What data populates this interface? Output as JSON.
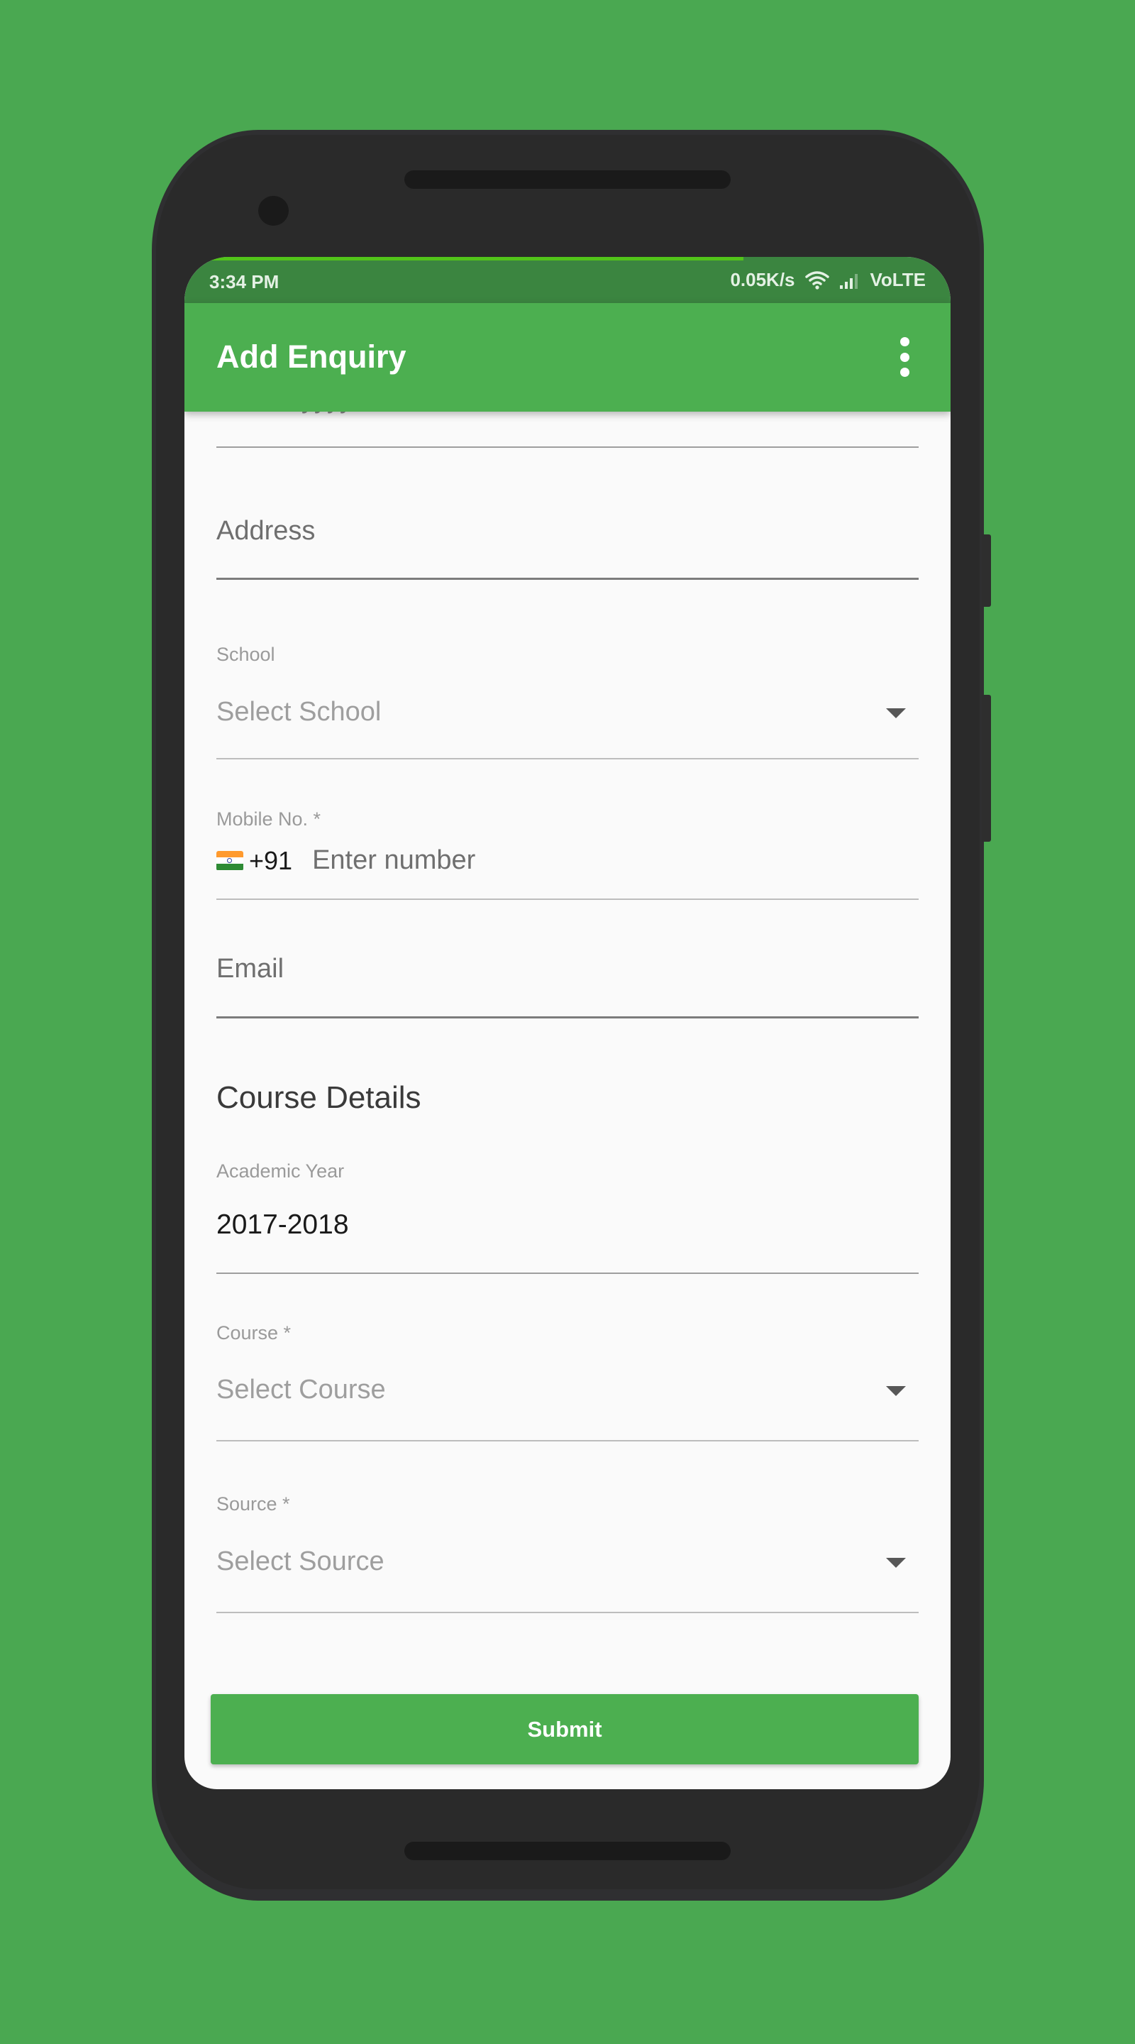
{
  "status_bar": {
    "time": "3:34 PM",
    "network_speed": "0.05K/s",
    "network_type": "VoLTE",
    "page_load_progress": 0.73,
    "icons": [
      "wifi-icon",
      "signal-icon"
    ]
  },
  "app_bar": {
    "title": "Add Enquiry",
    "menu_icon": "more-vert-icon"
  },
  "form": {
    "dob": {
      "placeholder": "dd mm yyyy"
    },
    "address": {
      "placeholder": "Address"
    },
    "school": {
      "label": "School",
      "value": "Select School"
    },
    "mobile": {
      "label": "Mobile No. *",
      "flag": "India flag",
      "country_code": "+91",
      "placeholder": "Enter number"
    },
    "email": {
      "placeholder": "Email"
    },
    "course_section_title": "Course Details",
    "academic_year": {
      "label": "Academic Year",
      "value": "2017-2018"
    },
    "course": {
      "label": "Course *",
      "value": "Select Course"
    },
    "source": {
      "label": "Source *",
      "value": "Select Source"
    },
    "submit_label": "Submit"
  },
  "colors": {
    "primary": "#4caf50",
    "primary_dark": "#3b8540",
    "background": "#4aa851",
    "progress": "#52c41a"
  }
}
